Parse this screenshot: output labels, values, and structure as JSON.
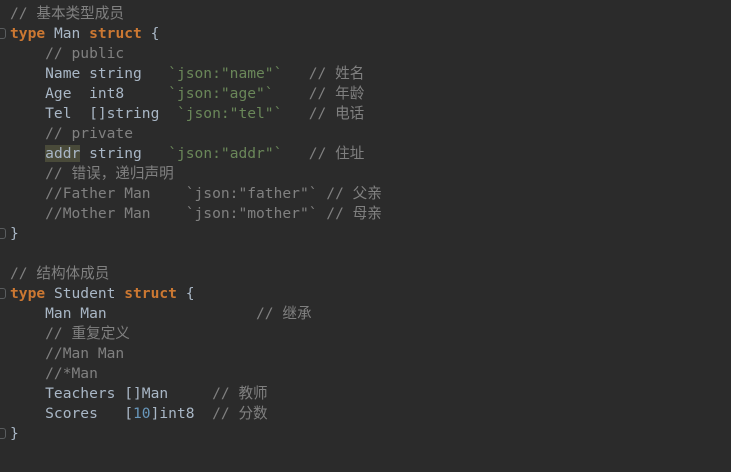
{
  "editor": {
    "lines": [
      {
        "fold": false,
        "tokens": [
          {
            "t": "cm",
            "v": "// 基本类型成员"
          }
        ]
      },
      {
        "fold": true,
        "tokens": [
          {
            "t": "kw",
            "v": "type"
          },
          {
            "t": "",
            "v": " Man "
          },
          {
            "t": "kw",
            "v": "struct"
          },
          {
            "t": "",
            "v": " {"
          }
        ]
      },
      {
        "fold": false,
        "tokens": [
          {
            "t": "cm",
            "v": "    // public"
          }
        ]
      },
      {
        "fold": false,
        "tokens": [
          {
            "t": "",
            "v": "    Name string   "
          },
          {
            "t": "tag",
            "v": "`json:\"name\"`"
          },
          {
            "t": "",
            "v": "   "
          },
          {
            "t": "cm",
            "v": "// 姓名"
          }
        ]
      },
      {
        "fold": false,
        "tokens": [
          {
            "t": "",
            "v": "    Age  int8     "
          },
          {
            "t": "tag",
            "v": "`json:\"age\"`"
          },
          {
            "t": "",
            "v": "    "
          },
          {
            "t": "cm",
            "v": "// 年龄"
          }
        ]
      },
      {
        "fold": false,
        "tokens": [
          {
            "t": "",
            "v": "    Tel  []string  "
          },
          {
            "t": "tag",
            "v": "`json:\"tel\"`"
          },
          {
            "t": "",
            "v": "   "
          },
          {
            "t": "cm",
            "v": "// 电话"
          }
        ]
      },
      {
        "fold": false,
        "tokens": [
          {
            "t": "cm",
            "v": "    // private"
          }
        ]
      },
      {
        "fold": false,
        "tokens": [
          {
            "t": "",
            "v": "    "
          },
          {
            "t": "hl",
            "v": "addr"
          },
          {
            "t": "",
            "v": " string   "
          },
          {
            "t": "tag",
            "v": "`json:\"addr\"`"
          },
          {
            "t": "",
            "v": "   "
          },
          {
            "t": "cm",
            "v": "// 住址"
          }
        ]
      },
      {
        "fold": false,
        "tokens": [
          {
            "t": "cm",
            "v": "    // 错误，递归声明"
          }
        ]
      },
      {
        "fold": false,
        "tokens": [
          {
            "t": "cm",
            "v": "    //Father Man    `json:\"father\"` // 父亲"
          }
        ]
      },
      {
        "fold": false,
        "tokens": [
          {
            "t": "cm",
            "v": "    //Mother Man    `json:\"mother\"` // 母亲"
          }
        ]
      },
      {
        "fold": true,
        "tokens": [
          {
            "t": "",
            "v": "}"
          }
        ]
      },
      {
        "fold": false,
        "tokens": [
          {
            "t": "",
            "v": ""
          }
        ]
      },
      {
        "fold": false,
        "tokens": [
          {
            "t": "cm",
            "v": "// 结构体成员"
          }
        ]
      },
      {
        "fold": true,
        "tokens": [
          {
            "t": "kw",
            "v": "type"
          },
          {
            "t": "",
            "v": " Student "
          },
          {
            "t": "kw",
            "v": "struct"
          },
          {
            "t": "",
            "v": " {"
          }
        ]
      },
      {
        "fold": false,
        "tokens": [
          {
            "t": "",
            "v": "    Man Man                 "
          },
          {
            "t": "cm",
            "v": "// 继承"
          }
        ]
      },
      {
        "fold": false,
        "tokens": [
          {
            "t": "cm",
            "v": "    // 重复定义"
          }
        ]
      },
      {
        "fold": false,
        "tokens": [
          {
            "t": "cm",
            "v": "    //Man Man"
          }
        ]
      },
      {
        "fold": false,
        "tokens": [
          {
            "t": "cm",
            "v": "    //*Man"
          }
        ]
      },
      {
        "fold": false,
        "tokens": [
          {
            "t": "",
            "v": "    Teachers []Man     "
          },
          {
            "t": "cm",
            "v": "// 教师"
          }
        ]
      },
      {
        "fold": false,
        "tokens": [
          {
            "t": "",
            "v": "    Scores   ["
          },
          {
            "t": "num",
            "v": "10"
          },
          {
            "t": "",
            "v": "]int8  "
          },
          {
            "t": "cm",
            "v": "// 分数"
          }
        ]
      },
      {
        "fold": true,
        "tokens": [
          {
            "t": "",
            "v": "}"
          }
        ]
      }
    ]
  }
}
